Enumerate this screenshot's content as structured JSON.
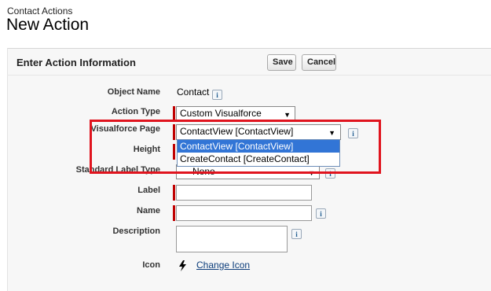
{
  "header": {
    "breadcrumb": "Contact Actions",
    "title": "New Action"
  },
  "panel": {
    "title": "Enter Action Information",
    "save_label": "Save",
    "cancel_label": "Cancel"
  },
  "form": {
    "object_name": {
      "label": "Object Name",
      "value": "Contact"
    },
    "action_type": {
      "label": "Action Type",
      "value": "Custom Visualforce"
    },
    "visualforce_page": {
      "label": "Visualforce Page",
      "value": "ContactView [ContactView]",
      "options": [
        "ContactView [ContactView]",
        "CreateContact [CreateContact]"
      ],
      "highlighted_option": "ContactView [ContactView]"
    },
    "height": {
      "label": "Height"
    },
    "standard_label_type": {
      "label": "Standard Label Type",
      "value": "--None--"
    },
    "label": {
      "label": "Label",
      "value": ""
    },
    "name": {
      "label": "Name",
      "value": ""
    },
    "description": {
      "label": "Description",
      "value": ""
    },
    "icon": {
      "label": "Icon",
      "link": "Change Icon"
    }
  },
  "icons": {
    "info": "i",
    "icon_glyph": "lightning-bolt-icon"
  },
  "colors": {
    "required_bar": "#c00000",
    "highlight_box": "#e0141e",
    "selected_option": "#3275d6"
  }
}
